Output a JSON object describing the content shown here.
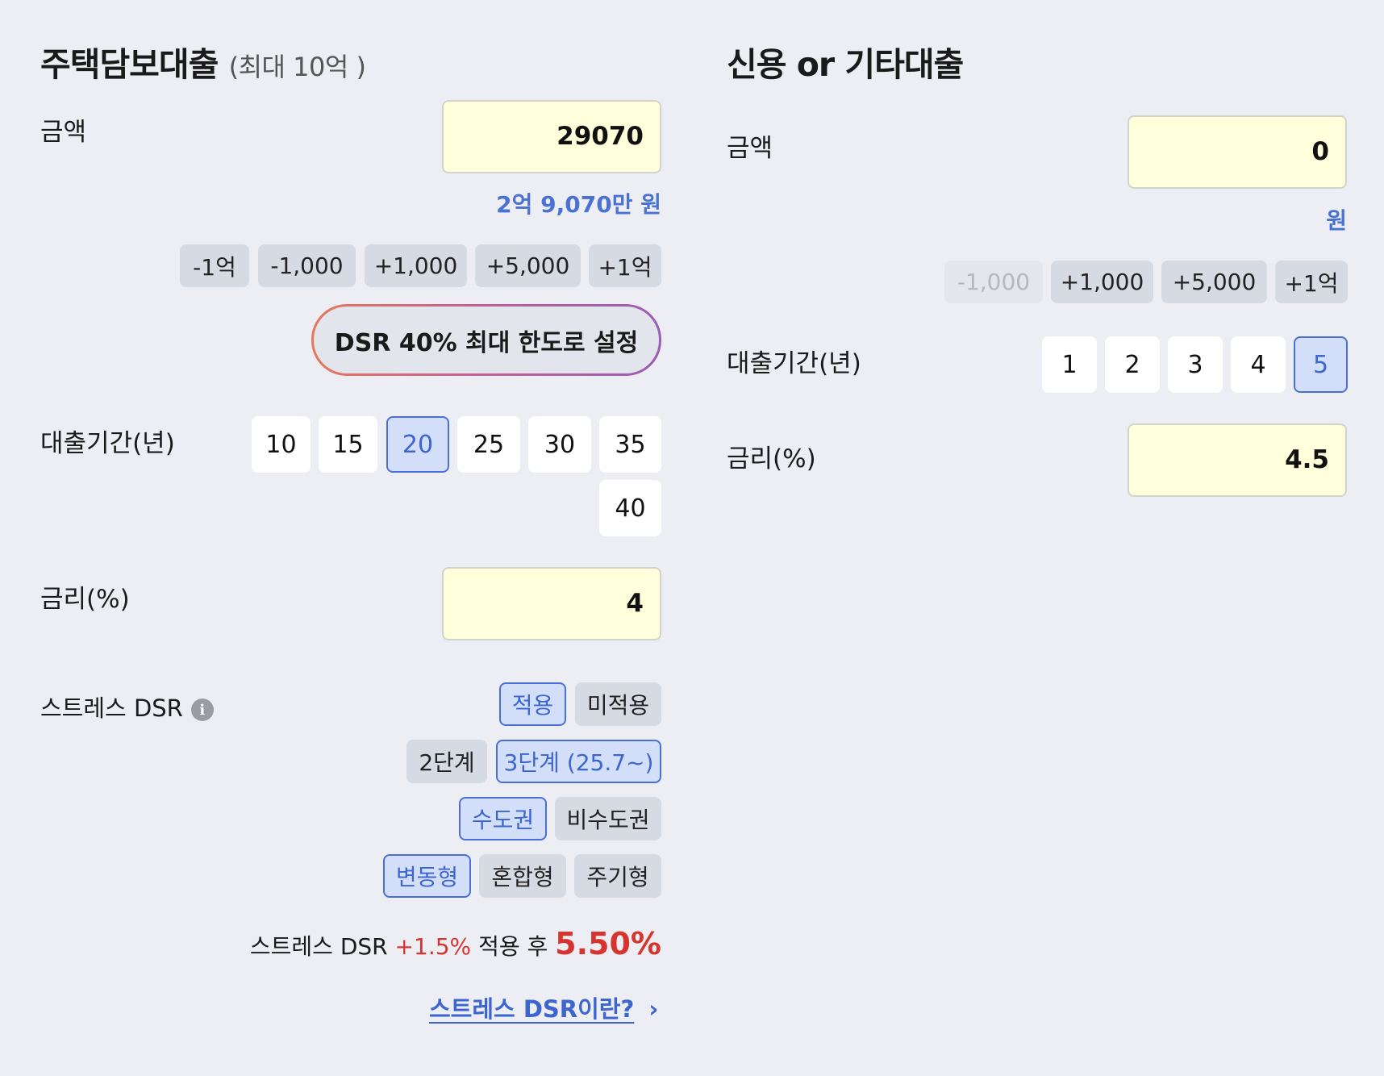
{
  "mortgage": {
    "title": "주택담보대출",
    "subtitle": "(최대 10억 )",
    "amount_label": "금액",
    "amount_value": "29070",
    "amount_hint": "2억 9,070만 원",
    "amount_buttons": [
      "-1억",
      "-1,000",
      "+1,000",
      "+5,000",
      "+1억"
    ],
    "dsr_max_button": "DSR 40% 최대 한도로 설정",
    "term_label": "대출기간(년)",
    "term_options": [
      "10",
      "15",
      "20",
      "25",
      "30",
      "35",
      "40"
    ],
    "term_selected": "20",
    "rate_label": "금리(%)",
    "rate_value": "4",
    "stress": {
      "label": "스트레스 DSR",
      "info_icon": "i",
      "apply_options": [
        "적용",
        "미적용"
      ],
      "apply_selected": "적용",
      "stage_options": [
        "2단계",
        "3단계 (25.7~)"
      ],
      "stage_selected": "3단계 (25.7~)",
      "region_options": [
        "수도권",
        "비수도권"
      ],
      "region_selected": "수도권",
      "type_options": [
        "변동형",
        "혼합형",
        "주기형"
      ],
      "type_selected": "변동형",
      "result_prefix": "스트레스 DSR",
      "result_add": "+1.5%",
      "result_mid": "적용 후",
      "result_value": "5.50%",
      "link_text": "스트레스 DSR이란?",
      "link_arrow": "›"
    }
  },
  "credit": {
    "title": "신용 or 기타대출",
    "amount_label": "금액",
    "amount_value": "0",
    "amount_hint": "원",
    "amount_buttons": [
      "-1,000",
      "+1,000",
      "+5,000",
      "+1억"
    ],
    "disabled_button": "-1,000",
    "term_label": "대출기간(년)",
    "term_options": [
      "1",
      "2",
      "3",
      "4",
      "5"
    ],
    "term_selected": "5",
    "rate_label": "금리(%)",
    "rate_value": "4.5"
  },
  "colors": {
    "background": "#eceef3",
    "input_background": "#ffffdc",
    "accent_blue": "#4a6fd6",
    "accent_red": "#d6342f"
  }
}
